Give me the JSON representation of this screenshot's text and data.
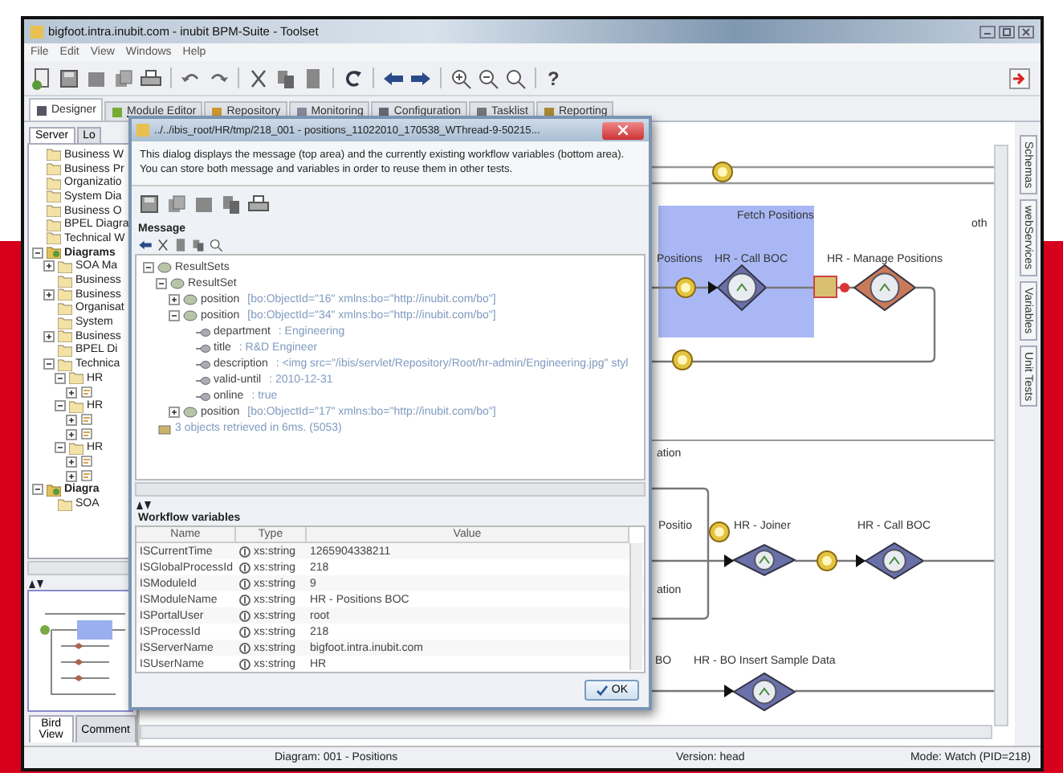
{
  "window": {
    "title": "bigfoot.intra.inubit.com - inubit BPM-Suite - Toolset"
  },
  "menu": [
    "File",
    "Edit",
    "View",
    "Windows",
    "Help"
  ],
  "toolbar": {
    "help": "?"
  },
  "tabs": [
    {
      "label": "Designer",
      "selected": true
    },
    {
      "label": "Module Editor",
      "selected": false
    },
    {
      "label": "Repository",
      "selected": false
    },
    {
      "label": "Monitoring",
      "selected": false
    },
    {
      "label": "Configuration",
      "selected": false
    },
    {
      "label": "Tasklist",
      "selected": false
    },
    {
      "label": "Reporting",
      "selected": false
    }
  ],
  "left_panel": {
    "tabs": [
      {
        "label": "Server",
        "selected": true
      },
      {
        "label": "Lo",
        "selected": false
      }
    ],
    "tree": [
      {
        "label": "Business W",
        "kind": "folder"
      },
      {
        "label": "Business Pr",
        "kind": "folder"
      },
      {
        "label": "Organizatio",
        "kind": "folder"
      },
      {
        "label": "System Dia",
        "kind": "folder"
      },
      {
        "label": "Business O",
        "kind": "folder"
      },
      {
        "label": "BPEL Diagra",
        "kind": "folder"
      },
      {
        "label": "Technical W",
        "kind": "folder"
      },
      {
        "label": "Diagrams",
        "kind": "root",
        "expanded": true,
        "children": [
          {
            "label": "SOA Ma",
            "kind": "folder",
            "expanded": false
          },
          {
            "label": "Business",
            "kind": "folder"
          },
          {
            "label": "Business",
            "kind": "folder",
            "expanded": false
          },
          {
            "label": "Organisat",
            "kind": "folder"
          },
          {
            "label": "System",
            "kind": "folder"
          },
          {
            "label": "Business",
            "kind": "folder",
            "expanded": false
          },
          {
            "label": "BPEL Di",
            "kind": "folder"
          },
          {
            "label": "Technica",
            "kind": "folder",
            "expanded": true,
            "children": [
              {
                "label": "HR",
                "kind": "folder",
                "expanded": true,
                "children": [
                  {
                    "kind": "diagram",
                    "expanded": false
                  }
                ]
              },
              {
                "label": "HR",
                "kind": "folder",
                "expanded": true,
                "children": [
                  {
                    "kind": "diagram",
                    "expanded": false
                  },
                  {
                    "kind": "diagram",
                    "expanded": false
                  }
                ]
              },
              {
                "label": "HR",
                "kind": "folder",
                "expanded": true,
                "children": [
                  {
                    "kind": "diagram",
                    "expanded": false
                  },
                  {
                    "kind": "diagram",
                    "expanded": false
                  }
                ]
              }
            ]
          }
        ]
      },
      {
        "label": "Diagra",
        "kind": "root",
        "expanded": true,
        "children": [
          {
            "label": "SOA",
            "kind": "folder"
          }
        ]
      }
    ],
    "bottom_tabs": [
      {
        "label": "Bird View",
        "selected": true
      },
      {
        "label": "Comment",
        "selected": false
      }
    ]
  },
  "canvas": {
    "labels": [
      "Fetch Positions",
      "oth",
      "Positions",
      "HR - Call BOC",
      "HR - Manage Positions",
      "ation",
      "Positio",
      "HR - Joiner",
      "HR - Call BOC",
      "ation",
      "BO",
      "HR - BO Insert Sample Data"
    ]
  },
  "side_tabs": [
    "Schemas",
    "webServices",
    "Variables",
    "Unit Tests"
  ],
  "status_bar": {
    "diagram": "Diagram: 001 - Positions",
    "version": "Version: head",
    "mode": "Mode: Watch (PID=218)"
  },
  "dialog": {
    "title": "../../ibis_root/HR/tmp/218_001 - positions_11022010_170538_WThread-9-50215...",
    "description": "This dialog displays the message (top area) and the currently existing workflow variables (bottom area). You can store both message and variables in order to reuse them in other tests.",
    "message_heading": "Message",
    "tree": [
      {
        "name": "ResultSets",
        "expanded": true,
        "children": [
          {
            "name": "ResultSet",
            "expanded": true,
            "children": [
              {
                "name": "position",
                "detail": "[bo:ObjectId=\"16\" xmlns:bo=\"http://inubit.com/bo\"]",
                "expanded": false
              },
              {
                "name": "position",
                "detail": "[bo:ObjectId=\"34\" xmlns:bo=\"http://inubit.com/bo\"]",
                "expanded": true,
                "children": [
                  {
                    "name": "department",
                    "detail": ": Engineering"
                  },
                  {
                    "name": "title",
                    "detail": ": R&D Engineer"
                  },
                  {
                    "name": "description",
                    "detail": ": <img src=\"/ibis/servlet/Repository/Root/hr-admin/Engineering.jpg\" styl"
                  },
                  {
                    "name": "valid-until",
                    "detail": ": 2010-12-31"
                  },
                  {
                    "name": "online",
                    "detail": ": true"
                  }
                ]
              },
              {
                "name": "position",
                "detail": "[bo:ObjectId=\"17\" xmlns:bo=\"http://inubit.com/bo\"]",
                "expanded": false
              }
            ]
          }
        ]
      },
      {
        "name": "3 objects retrieved in 6ms. (5053)",
        "kind": "info"
      }
    ],
    "variables_heading": "Workflow variables",
    "columns": [
      "Name",
      "Type",
      "Value"
    ],
    "rows": [
      {
        "name": "ISCurrentTime",
        "type": "xs:string",
        "value": "1265904338211"
      },
      {
        "name": "ISGlobalProcessId",
        "type": "xs:string",
        "value": "218"
      },
      {
        "name": "ISModuleId",
        "type": "xs:string",
        "value": "9"
      },
      {
        "name": "ISModuleName",
        "type": "xs:string",
        "value": "HR - Positions BOC"
      },
      {
        "name": "ISPortalUser",
        "type": "xs:string",
        "value": "root"
      },
      {
        "name": "ISProcessId",
        "type": "xs:string",
        "value": "218"
      },
      {
        "name": "ISServerName",
        "type": "xs:string",
        "value": "bigfoot.intra.inubit.com"
      },
      {
        "name": "ISUserName",
        "type": "xs:string",
        "value": "HR"
      }
    ],
    "ok_button": "OK"
  }
}
